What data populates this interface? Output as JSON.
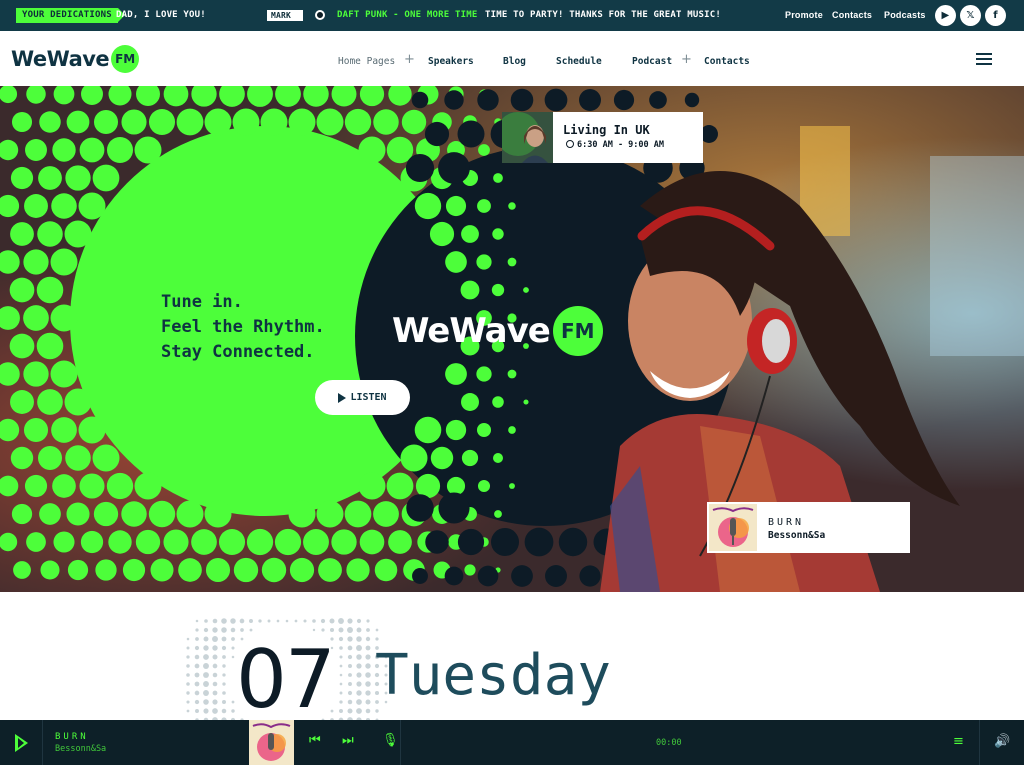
{
  "ticker": {
    "dedications_label": "YOUR DEDICATIONS",
    "dedication_message": "DAD, I LOVE YOU!",
    "sender_name": "MARK",
    "now_playing": "DAFT PUNK - ONE MORE TIME",
    "listener_message": "TIME TO PARTY! THANKS FOR THE GREAT MUSIC!",
    "links": [
      "Promote",
      "Contacts",
      "Podcasts"
    ],
    "social": [
      {
        "icon": "youtube-icon",
        "glyph": "▶"
      },
      {
        "icon": "x-icon",
        "glyph": "𝕏"
      },
      {
        "icon": "facebook-icon",
        "glyph": "f"
      }
    ]
  },
  "brand": {
    "word": "WeWave",
    "badge": "FM"
  },
  "nav": {
    "items": [
      "Home Pages",
      "Speakers",
      "Blog",
      "Schedule",
      "Podcast",
      "Contacts"
    ]
  },
  "hero": {
    "tagline": [
      "Tune in.",
      "Feel the Rhythm.",
      "Stay Connected."
    ],
    "listen_label": "LISTEN",
    "show": {
      "title": "Living In UK",
      "time": "6:30 AM - 9:00 AM"
    },
    "current_song": {
      "title": "BURN",
      "artist": "Bessonn&Sa"
    }
  },
  "schedule": {
    "day_number": "07",
    "day_name": "Tuesday"
  },
  "player": {
    "title": "BURN",
    "artist": "Bessonn&Sa",
    "elapsed": "00:00"
  },
  "colors": {
    "accent": "#4dfe3a",
    "navy": "#0e2d39",
    "player_bg": "#0d2028"
  }
}
